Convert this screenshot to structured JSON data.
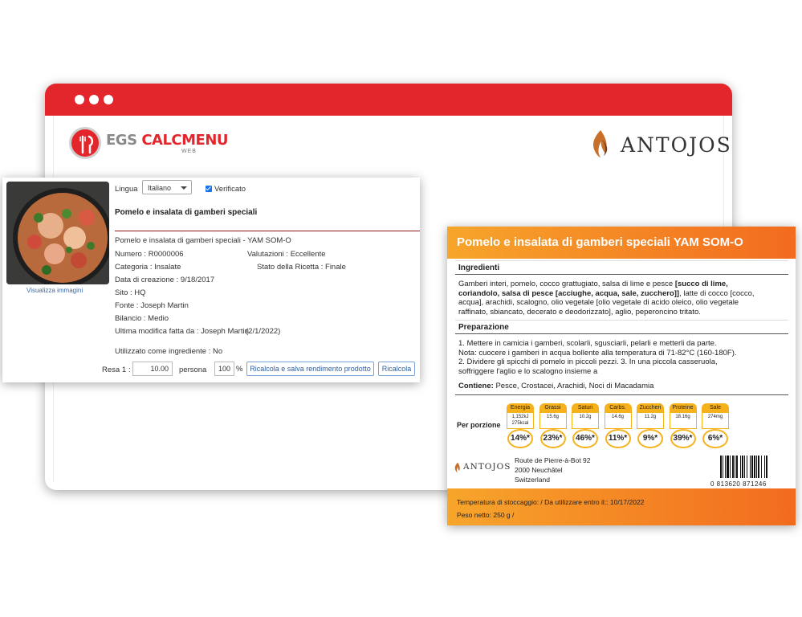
{
  "brand": {
    "egs_part1": "EGS ",
    "egs_part2": "CALCMENU",
    "egs_sub": "WEB",
    "antojos": "ANTOJOS"
  },
  "recipe": {
    "visualizza": "Visualizza immagini",
    "lingua_label": "Lingua",
    "lingua_value": "Italiano",
    "verificato_label": "Verificato",
    "title": "Pomelo e insalata di gamberi speciali",
    "subtitle": "Pomelo e insalata di gamberi speciali - YAM SOM-O",
    "numero": "Numero : R0000006",
    "valutazioni": "Valutazioni : Eccellente",
    "categoria": "Categoria : Insalate",
    "stato": "Stato della Ricetta : Finale",
    "data_creazione": "Data di creazione : 9/18/2017",
    "sito": "Sito : HQ",
    "fonte": "Fonte : Joseph Martin",
    "bilancio": "Bilancio : Medio",
    "ultima_modifica": "Ultima modifica fatta da : Joseph Martin",
    "ultima_data": "(2/1/2022)",
    "utilizzato": "Utilizzato come ingrediente : No",
    "resa_label": "Resa 1",
    "resa_colon": ":",
    "resa_value": "10.00",
    "persona_label": "persona",
    "pct_value": "100",
    "pct_sign": "%",
    "btn_ricalcola_salva": "Ricalcola e salva rendimento prodotto",
    "btn_ricalcola": "Ricalcola"
  },
  "label": {
    "title": "Pomelo e insalata di gamberi speciali YAM SOM-O",
    "ingredienti_head": "Ingredienti",
    "ingredienti_l1a": "Gamberi interi, pomelo, cocco grattugiato, salsa di lime e pesce ",
    "ingredienti_l1b": "[succo di lime,",
    "ingredienti_l2a": "coriandolo, salsa di pesce [acciughe, acqua, sale, zucchero]]",
    "ingredienti_l2b": ", latte di cocco [cocco,",
    "ingredienti_l3": "acqua], arachidi, scalogno, olio vegetale [olio vegetale di acido oleico, olio vegetale",
    "ingredienti_l4": "raffinato, sbiancato, decerato e deodorizzato], aglio, peperoncino tritato.",
    "preparazione_head": "Preparazione",
    "prep_l1": "1. Mettere in camicia i gamberi, scolarli, sgusciarli, pelarli e metterli da parte.",
    "prep_l2": "Nota: cuocere i gamberi in acqua bollente alla temperatura di 71-82°C (160-180F).",
    "prep_l3": "2. Dividere gli spicchi di pomelo in piccoli pezzi. 3. In una piccola casseruola,",
    "prep_l4": "soffriggere l'aglio e lo scalogno insieme a",
    "contiene_label": "Contiene:",
    "contiene_value": " Pesce, Crostacei, Arachidi, Noci di Macadamia",
    "per_porzione": "Per porzione",
    "nutrients": [
      {
        "name": "Energia",
        "amount": "1,152kJ",
        "amount2": "275kcal",
        "pct": "14%*"
      },
      {
        "name": "Grassi",
        "amount": "15.6g",
        "amount2": "",
        "pct": "23%*"
      },
      {
        "name": "Saturi",
        "amount": "10.2g",
        "amount2": "",
        "pct": "46%*"
      },
      {
        "name": "Carbs.",
        "amount": "14.6g",
        "amount2": "",
        "pct": "11%*"
      },
      {
        "name": "Zuccheri",
        "amount": "11.2g",
        "amount2": "",
        "pct": "9%*"
      },
      {
        "name": "Proteine",
        "amount": "18.16g",
        "amount2": "",
        "pct": "39%*"
      },
      {
        "name": "Sale",
        "amount": "274mg",
        "amount2": "",
        "pct": "6%*"
      }
    ],
    "addr1": "Route de Pierre-à-Bot 92",
    "addr2": "2000 Neuchâtel",
    "addr3": "Switzerland",
    "barcode_text": "0   813620   871246",
    "foot_l1": "Temperatura di stoccaggio:  / Da utilizzare entro il:: 10/17/2022",
    "foot_l2": "Peso netto: 250 g /"
  },
  "colors": {
    "brand_red": "#e3262b",
    "label_orange": "#f26b1f",
    "badge_yellow": "#f6b21c"
  }
}
